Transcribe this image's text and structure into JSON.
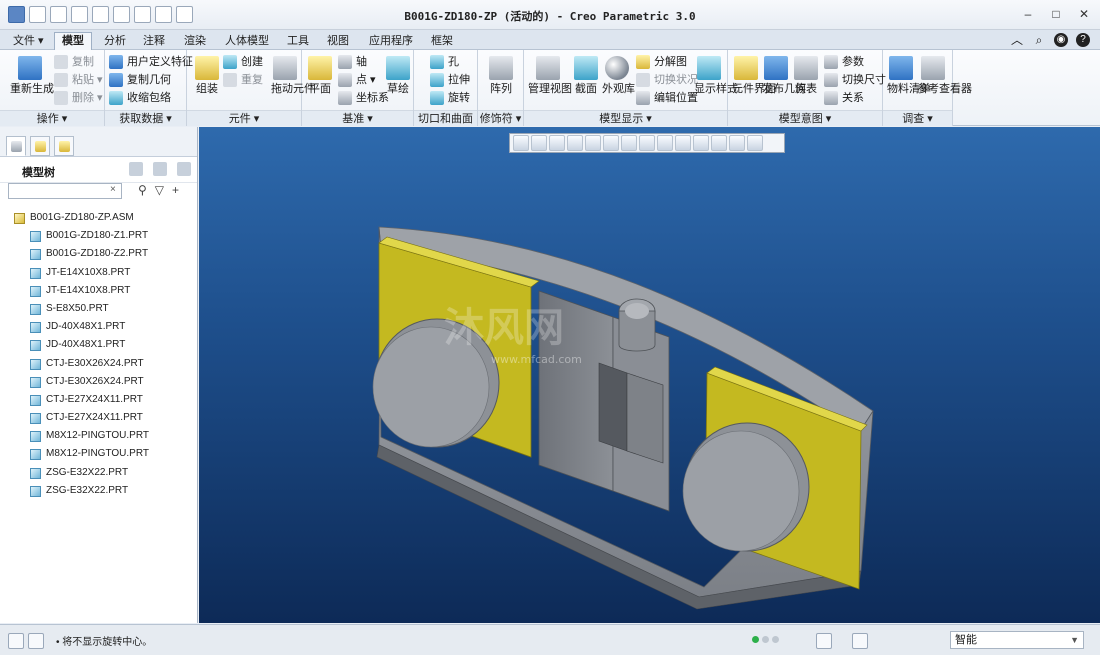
{
  "window": {
    "title": "B001G-ZD180-ZP (活动的) - Creo Parametric 3.0"
  },
  "tabs": [
    "文件 ▾",
    "模型",
    "分析",
    "注释",
    "渲染",
    "人体模型",
    "工具",
    "视图",
    "应用程序",
    "框架"
  ],
  "ribbon": {
    "groups": [
      {
        "label": "操作 ▾",
        "buttons": [
          "重新生成",
          "复制",
          "粘贴 ▾",
          "删除 ▾"
        ]
      },
      {
        "label": "获取数据 ▾",
        "buttons": [
          "用户定义特征",
          "复制几何",
          "收缩包络"
        ]
      },
      {
        "label": "元件 ▾",
        "buttons": [
          "组装",
          "创建",
          "重复",
          "拖动元件"
        ]
      },
      {
        "label": "基准 ▾",
        "buttons": [
          "平面",
          "轴",
          "点 ▾",
          "坐标系",
          "草绘"
        ]
      },
      {
        "label": "切口和曲面 ▾",
        "buttons": [
          "孔",
          "拉伸",
          "旋转"
        ]
      },
      {
        "label": "修饰符 ▾",
        "buttons": [
          "阵列"
        ]
      },
      {
        "label": "模型显示 ▾",
        "buttons": [
          "管理视图",
          "截面",
          "外观库",
          "分解图",
          "切换状况",
          "编辑位置",
          "显示样式"
        ]
      },
      {
        "label": "模型意图 ▾",
        "buttons": [
          "元件界面",
          "发布几何",
          "族表",
          "参数",
          "切换尺寸",
          "关系"
        ]
      },
      {
        "label": "调查 ▾",
        "buttons": [
          "物料清单",
          "参考查看器"
        ]
      }
    ]
  },
  "panel": {
    "tree_label": "模型树",
    "search_value": "",
    "clear": "×",
    "root": "B001G-ZD180-ZP.ASM",
    "items": [
      "B001G-ZD180-Z1.PRT",
      "B001G-ZD180-Z2.PRT",
      "JT-E14X10X8.PRT",
      "JT-E14X10X8.PRT",
      "S-E8X50.PRT",
      "JD-40X48X1.PRT",
      "JD-40X48X1.PRT",
      "CTJ-E30X26X24.PRT",
      "CTJ-E30X26X24.PRT",
      "CTJ-E27X24X11.PRT",
      "CTJ-E27X24X11.PRT",
      "M8X12-PINGTOU.PRT",
      "M8X12-PINGTOU.PRT",
      "ZSG-E32X22.PRT",
      "ZSG-E32X22.PRT"
    ]
  },
  "status": {
    "message": "• 将不显示旋转中心。",
    "filter_value": "智能"
  },
  "viewport": {
    "watermark_main": "沐风网",
    "watermark_url": "www.mfcad.com"
  },
  "colors": {
    "accent_tab": "#f4f7fb",
    "viewport_top": "#2e6aad",
    "viewport_bottom": "#0d2a57",
    "part_grey": "#8f9399",
    "part_yellow": "#c4b920"
  }
}
